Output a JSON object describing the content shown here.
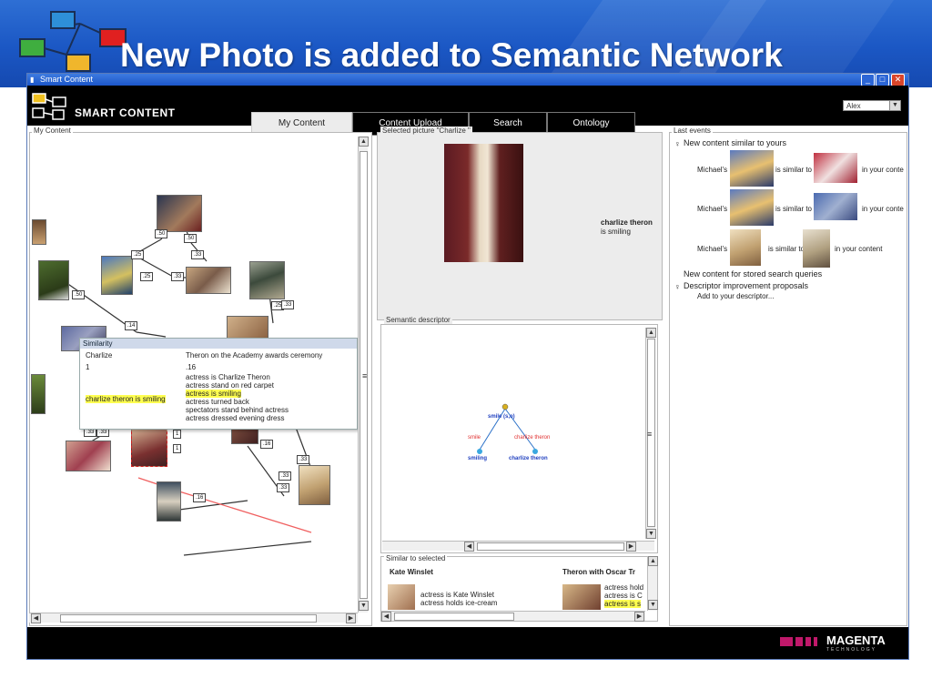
{
  "slide": {
    "title": "New Photo is added to Semantic Network"
  },
  "window": {
    "title": "Smart Content",
    "minimize": "_",
    "maximize": "□",
    "close": "✕"
  },
  "app": {
    "logo_text": "SMART CONTENT",
    "tabs": [
      {
        "label": "My Content",
        "active": true
      },
      {
        "label": "Content Upload",
        "active": false
      },
      {
        "label": "Search",
        "active": false
      },
      {
        "label": "Ontology",
        "active": false
      }
    ],
    "user": "Alex"
  },
  "my_content": {
    "label": "My Content",
    "edge_labels": [
      ".50",
      ".50",
      ".25",
      ".33",
      ".25",
      ".33",
      ".50",
      ".25",
      ".14",
      ".33",
      ".16",
      ".33",
      ".33",
      "1",
      "1",
      ".33",
      ".16",
      ".33",
      ".33"
    ],
    "popup": {
      "title": "Similarity",
      "left_name": "Charlize",
      "right_name": "Theron on the Academy awards ceremony",
      "left_value": "1",
      "right_value": ".16",
      "left_match": "charlize theron is smiling",
      "right_lines": [
        "actress is Charlize Theron",
        "actress stand on red carpet",
        "actress is smiling",
        "actress turned back",
        "spectators stand behind actress",
        "actress dressed evening dress"
      ]
    }
  },
  "selected": {
    "label": "Selected picture \"Charlize \"",
    "caption_line1": "charlize theron",
    "caption_line2": "is smiling"
  },
  "descriptor": {
    "label": "Semantic descriptor",
    "root": "smile (s,o)",
    "left_edge": "smile",
    "right_edge": "charlize theron",
    "left_leaf": "smiling",
    "right_leaf": "charlize theron"
  },
  "similar": {
    "label": "Similar to selected",
    "item1_title": "Kate Winslet",
    "item1_lines": [
      "actress is Kate Winslet",
      "actress holds ice-cream"
    ],
    "item2_title": "Theron with Oscar Tr",
    "item2_lines": [
      "actress hold",
      "actress is C",
      "actress is s"
    ]
  },
  "events": {
    "label": "Last events",
    "group1": "New content similar to yours",
    "rows": [
      {
        "who": "Michael's",
        "mid": "is similar to",
        "end": "in your conte"
      },
      {
        "who": "Michael's",
        "mid": "is similar to",
        "end": "in your conte"
      },
      {
        "who": "Michael's",
        "mid": "is similar to",
        "end": "in your content"
      }
    ],
    "group2": "New content for stored search queries",
    "group3": "Descriptor improvement proposals",
    "group3_child": "Add to your descriptor..."
  },
  "footer": {
    "brand": "MAGENTA",
    "sub": "TECHNOLOGY"
  }
}
